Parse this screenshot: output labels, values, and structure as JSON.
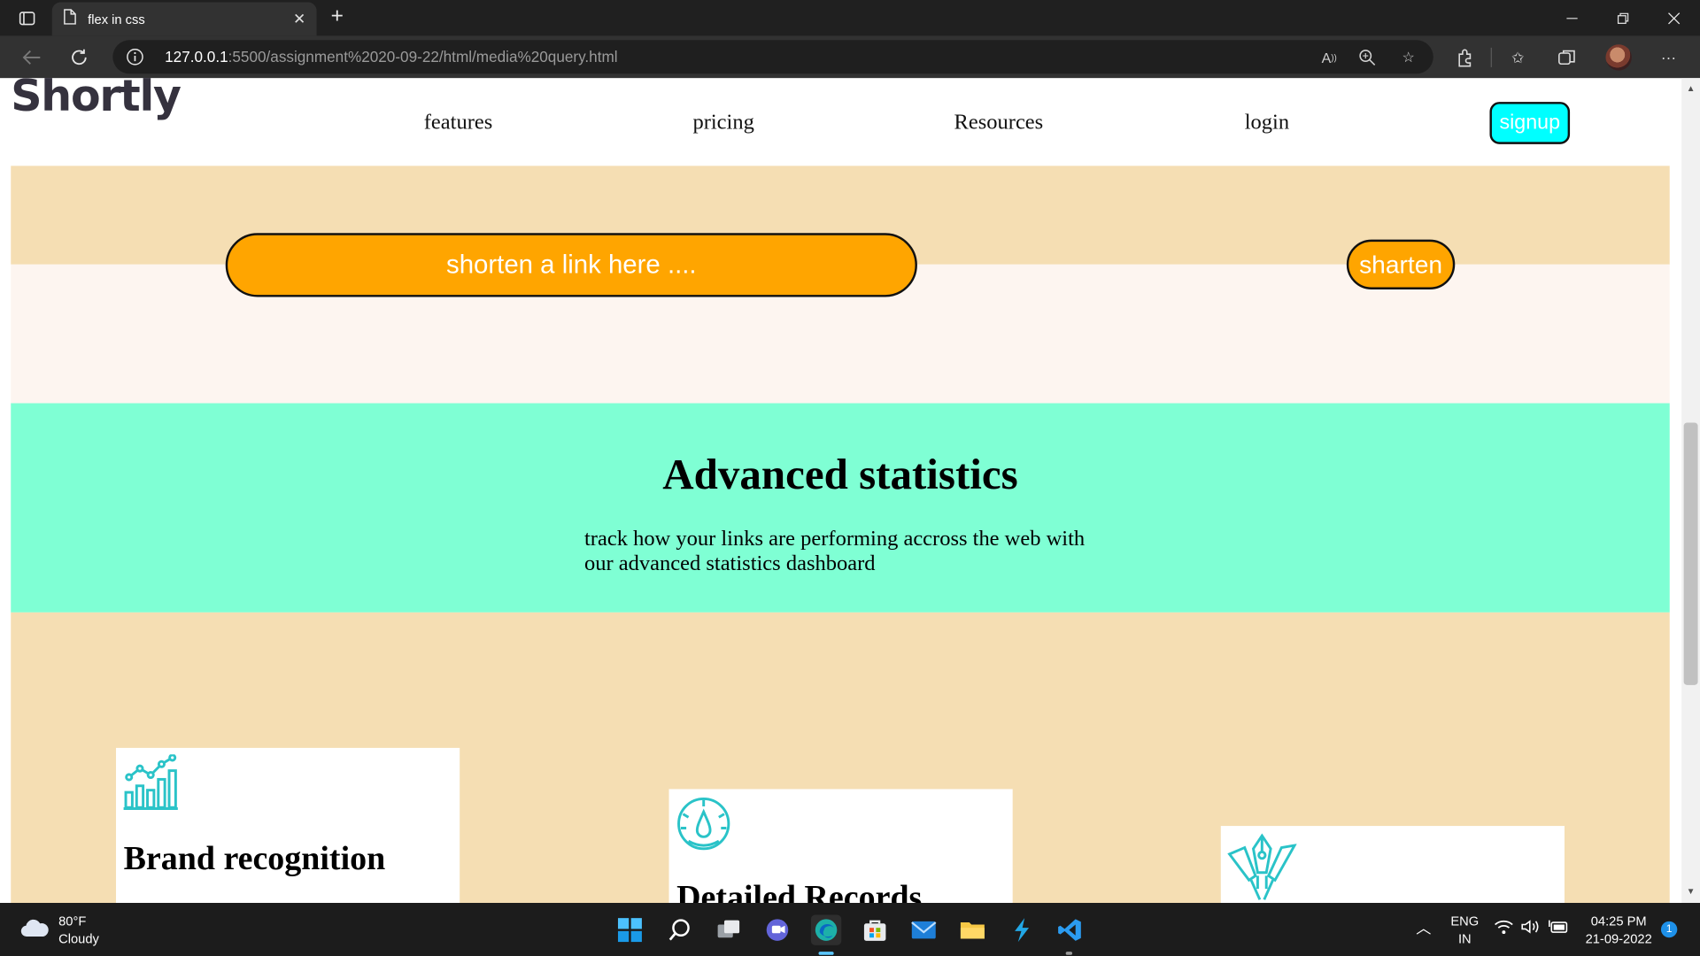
{
  "browser": {
    "tab_title": "flex in css",
    "new_tab": "+",
    "url_host": "127.0.0.1",
    "url_rest": ":5500/assignment%2020-09-22/html/media%20query.html"
  },
  "page": {
    "logo": "Shortly",
    "nav": [
      "features",
      "pricing",
      "Resources",
      "login"
    ],
    "signup": "signup",
    "shorten_placeholder": "shorten a link here ....",
    "shorten_button": "sharten",
    "stats_title": "Advanced statistics",
    "stats_desc": "track how your links are performing accross the web with our advanced statistics dashboard",
    "cards": [
      {
        "title": "Brand recognition",
        "icon": "bar-chart-icon"
      },
      {
        "title": "Detailed Records",
        "icon": "gauge-icon"
      },
      {
        "title": "",
        "icon": "pen-tools-icon"
      }
    ]
  },
  "taskbar": {
    "temp": "80°F",
    "condition": "Cloudy",
    "lang_line1": "ENG",
    "lang_line2": "IN",
    "time": "04:25 PM",
    "date": "21-09-2022",
    "notification_count": "1"
  },
  "colors": {
    "accent_orange": "#ffa500",
    "aqua": "#00ffff",
    "stats_bg": "#7fffd4",
    "wheat": "#f5deb3",
    "icon_teal": "#2ac3c8"
  }
}
